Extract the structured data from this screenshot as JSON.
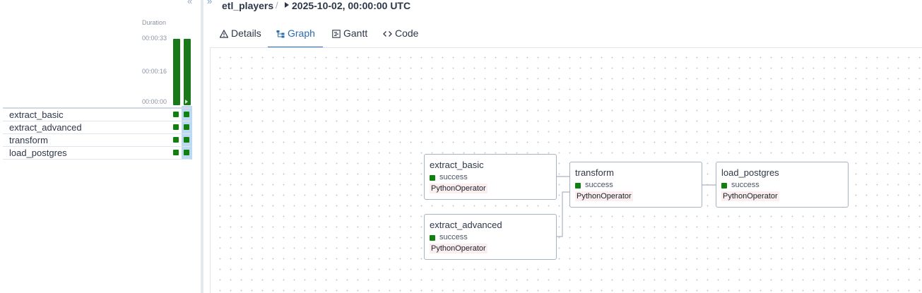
{
  "grid": {
    "duration_label": "Duration",
    "ticks": [
      "00:00:33",
      "00:00:16",
      "00:00:00"
    ],
    "collapse_icon": "double-chevron-left-icon",
    "tasks": [
      {
        "name": "extract_basic"
      },
      {
        "name": "extract_advanced"
      },
      {
        "name": "transform"
      },
      {
        "name": "load_postgres"
      }
    ],
    "success_color": "#118011"
  },
  "breadcrumb": {
    "dag_id": "etl_players",
    "separator": "/",
    "run": "2025-10-02, 00:00:00 UTC"
  },
  "tabs": [
    {
      "label": "Details",
      "icon": "warning-triangle-icon",
      "active": false
    },
    {
      "label": "Graph",
      "icon": "graph-icon",
      "active": true
    },
    {
      "label": "Gantt",
      "icon": "gantt-icon",
      "active": false
    },
    {
      "label": "Code",
      "icon": "code-icon",
      "active": false
    }
  ],
  "graph": {
    "nodes": [
      {
        "id": "extract_basic",
        "state": "success",
        "operator": "PythonOperator"
      },
      {
        "id": "extract_advanced",
        "state": "success",
        "operator": "PythonOperator"
      },
      {
        "id": "transform",
        "state": "success",
        "operator": "PythonOperator"
      },
      {
        "id": "load_postgres",
        "state": "success",
        "operator": "PythonOperator"
      }
    ],
    "edges": [
      [
        "extract_basic",
        "transform"
      ],
      [
        "extract_advanced",
        "transform"
      ],
      [
        "transform",
        "load_postgres"
      ]
    ]
  }
}
